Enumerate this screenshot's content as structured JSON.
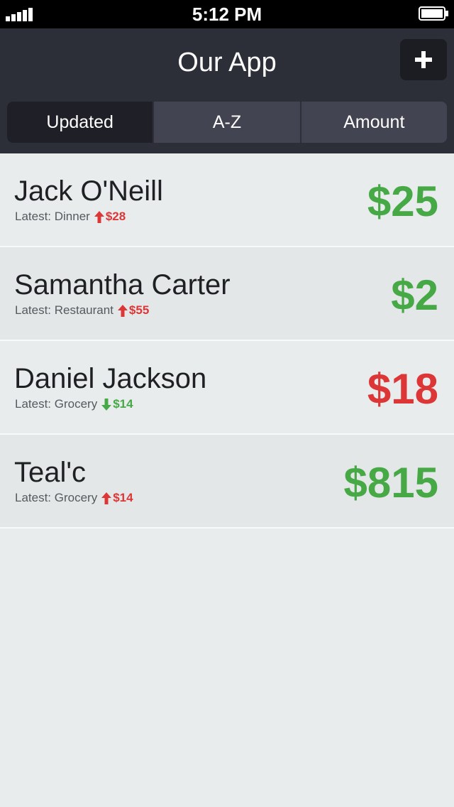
{
  "status_bar": {
    "time": "5:12 PM",
    "signal_icon": "signal-bars-icon",
    "battery_icon": "battery-icon"
  },
  "nav": {
    "title": "Our App",
    "add_icon": "plus-icon"
  },
  "tabs": [
    {
      "label": "Updated",
      "selected": true
    },
    {
      "label": "A-Z",
      "selected": false
    },
    {
      "label": "Amount",
      "selected": false
    }
  ],
  "colors": {
    "positive": "#46a946",
    "negative": "#dc3636",
    "navbar": "#2c2e38"
  },
  "people": [
    {
      "name": "Jack O'Neill",
      "latest_label": "Latest: Dinner",
      "delta": "$28",
      "direction": "up",
      "amount": "$25",
      "amount_status": "positive"
    },
    {
      "name": "Samantha Carter",
      "latest_label": "Latest: Restaurant",
      "delta": "$55",
      "direction": "up",
      "amount": "$2",
      "amount_status": "positive"
    },
    {
      "name": "Daniel Jackson",
      "latest_label": "Latest: Grocery",
      "delta": "$14",
      "direction": "down",
      "amount": "$18",
      "amount_status": "negative"
    },
    {
      "name": "Teal'c",
      "latest_label": "Latest: Grocery",
      "delta": "$14",
      "direction": "up",
      "amount": "$815",
      "amount_status": "positive"
    }
  ]
}
